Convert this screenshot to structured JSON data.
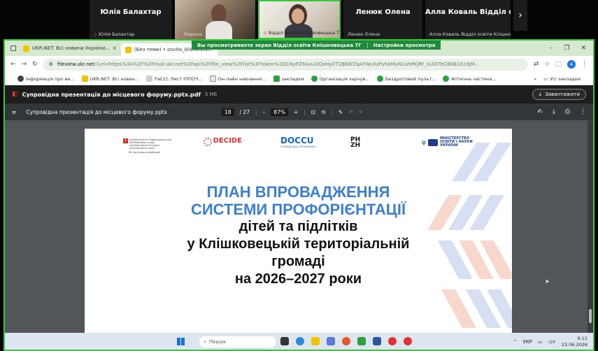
{
  "participants": [
    {
      "big": "Юлія Балахтар",
      "label": "Юлія Балахтар",
      "muted": true
    },
    {
      "big": "",
      "label": "Марина",
      "muted": true
    },
    {
      "big": "",
      "label": "Відділ освіти Клішковецька ТГ",
      "muted": true
    },
    {
      "big": "Ленюк Олена",
      "label": "Ленюк Олена",
      "muted": false
    },
    {
      "big": "Алла Коваль Відділ ос...",
      "label": "Алла Коваль Відділ освіти Клішко...",
      "muted": false
    }
  ],
  "next_icon": "›",
  "banner": {
    "message": "Вы просматриваете экран Відділ освіти Клішковецька ТГ",
    "settings": "Настройки просмотра"
  },
  "browser": {
    "tabs": [
      {
        "label": "UKR.NET: Всі новини України..."
      },
      {
        "label": "(Без теми) • osvita_klishkivtsi..."
      }
    ],
    "url_host": "fileview.ukr.net",
    "url_rest": "/?url=https%3A%2F%2Fmail.ukr.net%2Fapi%2Ffile_view%2Flist%3Ftoken%3D1NyPZ8AzuI2QxHy0T1BBWZqAYWuXzPyfaIMyN1ahPKjRY_kUiDTeCBNE1Kz3JM...",
    "avatar": "A",
    "bookmarks": [
      "Інформація про ви...",
      "UKR.NET: Всі новин...",
      "Fw[2]: Лист ІППОЧ...",
      "Он-лайн навчання...",
      "закладки",
      "Організація харчув...",
      "Бездротовий пульт...",
      "Аптечна частина..."
    ],
    "all_bookmarks": "Усі закладки",
    "more_bookmarks": "»"
  },
  "file": {
    "name": "Супровідна презентація до місцевого форуму.pptx.pdf",
    "size": "5 МБ",
    "download": "Завантажити"
  },
  "pdf": {
    "title": "Супровідна презентація до місцевого форуму.pptx",
    "page": "18",
    "total": "/ 27",
    "zoom": "87%"
  },
  "slide": {
    "logos": {
      "swiss": "Schweizerische Eidgenossenschaft\nConfédération suisse\nConfederazione Svizzera\nConfederaziun svizra",
      "swiss_note": "Як підтримки Швейцарії",
      "decide": "DECIDE",
      "doccu": "DOCCU",
      "doccu_sub": "ГРОМАДСЬКА ОРГАНІЗАЦІЯ",
      "phzh": "PH\nZH",
      "mon": "МІНІСТЕРСТВО\nОСВІТИ І НАУКИ\nУКРАЇНИ"
    },
    "line1": "ПЛАН ВПРОВАДЖЕННЯ",
    "line2": "СИСТЕМИ ПРОФОРІЄНТАЦІЇ",
    "line3": "дітей та підлітків",
    "line4": "у Клішковецькій територіальній",
    "line5": "громаді",
    "line6": "на 2026–2027 роки"
  },
  "taskbar": {
    "search": "Пошук",
    "lang": "УКР",
    "time": "9:11",
    "date": "23.06.2026"
  }
}
